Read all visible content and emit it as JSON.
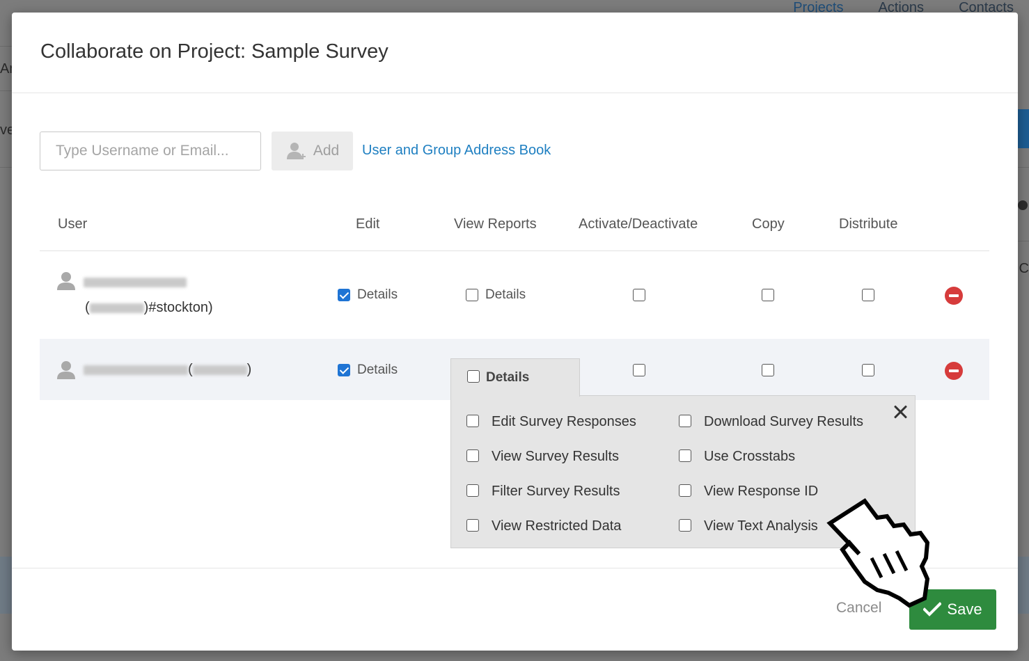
{
  "background": {
    "nav": [
      "Projects",
      "Actions",
      "Contacts"
    ],
    "fragments": [
      "An",
      "ve",
      "C"
    ]
  },
  "modal": {
    "title": "Collaborate on Project: Sample Survey",
    "search": {
      "placeholder": "Type Username or Email...",
      "value": ""
    },
    "add_label": "Add",
    "address_book_link": "User and Group Address Book",
    "columns": [
      "User",
      "Edit",
      "View Reports",
      "Activate/Deactivate",
      "Copy",
      "Distribute"
    ],
    "rows": [
      {
        "name_suffix": ")#stockton)",
        "name_prefix": "(",
        "edit": {
          "checked": true,
          "label": "Details"
        },
        "view_reports": {
          "checked": false,
          "label": "Details"
        },
        "activate": false,
        "copy": false,
        "distribute": false
      },
      {
        "name_open": "(",
        "name_close": ")",
        "edit": {
          "checked": true,
          "label": "Details"
        },
        "view_reports": {
          "checked": false,
          "label": "Details"
        },
        "activate": false,
        "copy": false,
        "distribute": false
      }
    ],
    "details_popover": {
      "tab_label": "Details",
      "options_left": [
        "Edit Survey Responses",
        "View Survey Results",
        "Filter Survey Results",
        "View Restricted Data"
      ],
      "options_right": [
        "Download Survey Results",
        "Use Crosstabs",
        "View Response ID",
        "View Text Analysis"
      ]
    },
    "footer": {
      "cancel": "Cancel",
      "save": "Save"
    }
  },
  "colors": {
    "accent_blue": "#1e7fc1",
    "save_green": "#2e8b3e",
    "remove_red": "#d63b3b"
  }
}
